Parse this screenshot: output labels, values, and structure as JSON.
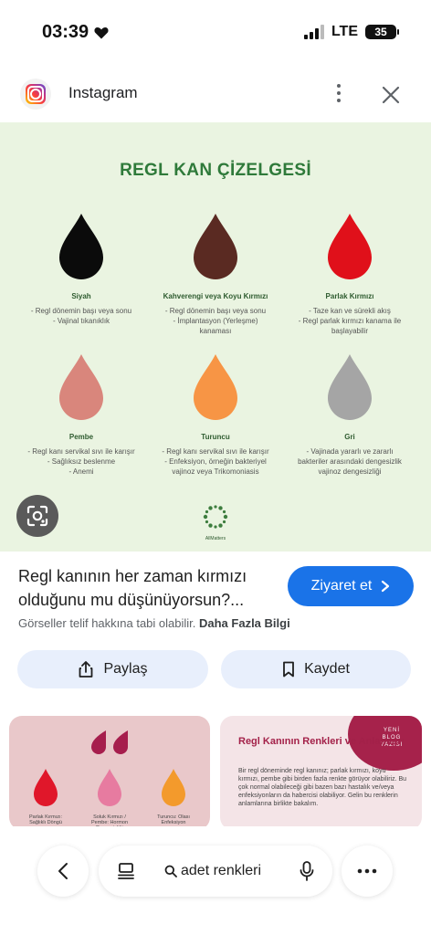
{
  "status_bar": {
    "time": "03:39",
    "network": "LTE",
    "battery": "35"
  },
  "source": {
    "name": "Instagram"
  },
  "image": {
    "title": "REGL KAN ÇİZELGESİ",
    "drops": [
      {
        "name": "Siyah",
        "color": "#0b0b0b",
        "lines": [
          "- Regl dönemin başı veya sonu",
          "- Vajinal tıkanıklık"
        ]
      },
      {
        "name": "Kahverengi veya Koyu Kırmızı",
        "color": "#5a2a22",
        "lines": [
          "- Regl dönemin başı veya sonu",
          "- İmplantasyon (Yerleşme)",
          "kanaması"
        ]
      },
      {
        "name": "Parlak Kırmızı",
        "color": "#e0101a",
        "lines": [
          "- Taze kan ve sürekli akış",
          "- Regl parlak kırmızı kanama ile",
          "başlayabilir"
        ]
      },
      {
        "name": "Pembe",
        "color": "#d9867c",
        "lines": [
          "- Regl kanı servikal sıvı ile karışır",
          "- Sağlıksız beslenme",
          "- Anemi"
        ]
      },
      {
        "name": "Turuncu",
        "color": "#f79545",
        "lines": [
          "- Regl kanı servikal sıvı ile karışır",
          "- Enfeksiyon, örneğin bakteriyel",
          "vajinoz veya Trikomoniasis"
        ]
      },
      {
        "name": "Gri",
        "color": "#a5a5a5",
        "lines": [
          "- Vajinada yararlı ve zararlı",
          "bakteriler arasındaki dengesizlik",
          "vajinoz dengesizliği"
        ]
      }
    ],
    "brand": "AllMatters",
    "lens_icon": "lens-icon"
  },
  "caption": "Regl kanının her zaman kırmızı olduğunu mu düşünüyorsun?...",
  "visit_button": "Ziyaret et",
  "copyright": {
    "text": "Görseller telif hakkına tabi olabilir.",
    "link": "Daha Fazla Bilgi"
  },
  "actions": {
    "share": "Paylaş",
    "save": "Kaydet"
  },
  "related": {
    "left": {
      "drops": [
        {
          "label": "Parlak Kırmızı: Sağlıklı Döngü",
          "color": "#e0172a"
        },
        {
          "label": "Soluk Kırmızı / Pembe: Hormon Dengesizliği",
          "color": "#e77ba0"
        },
        {
          "label": "Turuncu: Olası Enfeksiyon",
          "color": "#f39a2c"
        }
      ]
    },
    "right": {
      "badge": "YENİ BLOG YAZISI",
      "heading": "Regl Kanının Renkleri ve Anlamları",
      "body": "Bir regl döneminde regl kanınız; parlak kırmızı, koyu kırmızı, pembe gibi birden fazla renkte görüyor olabiliriz. Bu çok normal olabileceği gibi bazen bazı hastalık ve/veya enfeksiyonların da habercisi olabiliyor. Gelin bu renklerin anlamlarına birlikte bakalım."
    }
  },
  "bottom_bar": {
    "query": "adet renkleri"
  },
  "colors": {
    "accent": "#1a73e8",
    "action_bg": "#e8effc",
    "panel_bg": "#eaf4e1",
    "title_green": "#2f7a3a"
  }
}
